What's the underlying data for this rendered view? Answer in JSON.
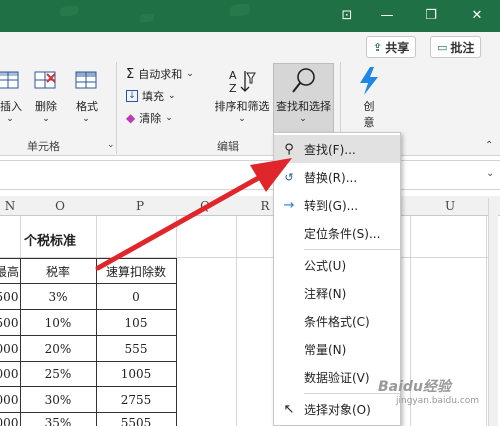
{
  "titlebar": {
    "icons": [
      "ribbon-display-icon",
      "minimize-icon",
      "restore-icon",
      "close-icon"
    ]
  },
  "actions": {
    "share": "共享",
    "comment": "批注"
  },
  "ribbon": {
    "cells_group": {
      "insert": "插入",
      "delete": "删除",
      "format": "格式",
      "label": "单元格"
    },
    "edit_group": {
      "autosum": "自动求和",
      "fill": "填充",
      "clear": "清除",
      "sort_filter": "排序和筛选",
      "find_select": "查找和选择",
      "label": "编辑"
    },
    "creative": {
      "label1": "创",
      "label2": "意"
    }
  },
  "columns": {
    "n": "N",
    "o": "O",
    "p": "P",
    "q": "Q",
    "r": "R",
    "u": "U"
  },
  "table": {
    "title": "个税标准",
    "headers": [
      "最高",
      "税率",
      "速算扣除数"
    ],
    "rows": [
      [
        "500",
        "3%",
        "0"
      ],
      [
        "500",
        "10%",
        "105"
      ],
      [
        "000",
        "20%",
        "555"
      ],
      [
        "000",
        "25%",
        "1005"
      ],
      [
        "000",
        "30%",
        "2755"
      ],
      [
        "000",
        "35%",
        "5505"
      ]
    ]
  },
  "menu": {
    "items": [
      {
        "label": "查找(F)...",
        "icon": "search-icon"
      },
      {
        "label": "替换(R)...",
        "icon": "replace-icon"
      },
      {
        "label": "转到(G)...",
        "icon": "arrow-right-icon"
      },
      {
        "label": "定位条件(S)...",
        "icon": ""
      },
      {
        "label": "公式(U)",
        "icon": ""
      },
      {
        "label": "注释(N)",
        "icon": ""
      },
      {
        "label": "条件格式(C)",
        "icon": ""
      },
      {
        "label": "常量(N)",
        "icon": ""
      },
      {
        "label": "数据验证(V)",
        "icon": ""
      },
      {
        "label": "选择对象(O)",
        "icon": "pointer-icon"
      }
    ]
  },
  "watermark": {
    "brand": "Baidu经验",
    "url": "jingyan.baidu.com"
  },
  "colors": {
    "excel_green": "#1f7145",
    "arrow_red": "#e0262a"
  }
}
